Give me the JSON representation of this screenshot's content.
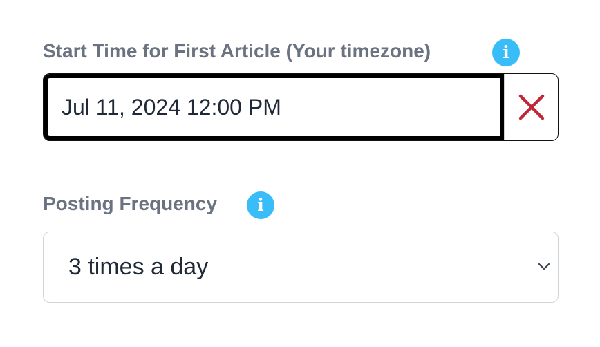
{
  "start_time": {
    "label": "Start Time for First Article (Your timezone)",
    "info_icon_glyph": "i",
    "value": "Jul 11, 2024 12:00 PM",
    "clear_icon": "close-x-icon",
    "clear_icon_color": "#c0283a"
  },
  "posting_frequency": {
    "label": "Posting Frequency",
    "info_icon_glyph": "i",
    "selected": "3 times a day",
    "dropdown_icon": "chevron-down-icon"
  },
  "colors": {
    "label": "#6b7280",
    "info_icon_bg": "#38bdf8",
    "text": "#1f2937",
    "border": "#d1d5db",
    "focus_border": "#000000"
  }
}
